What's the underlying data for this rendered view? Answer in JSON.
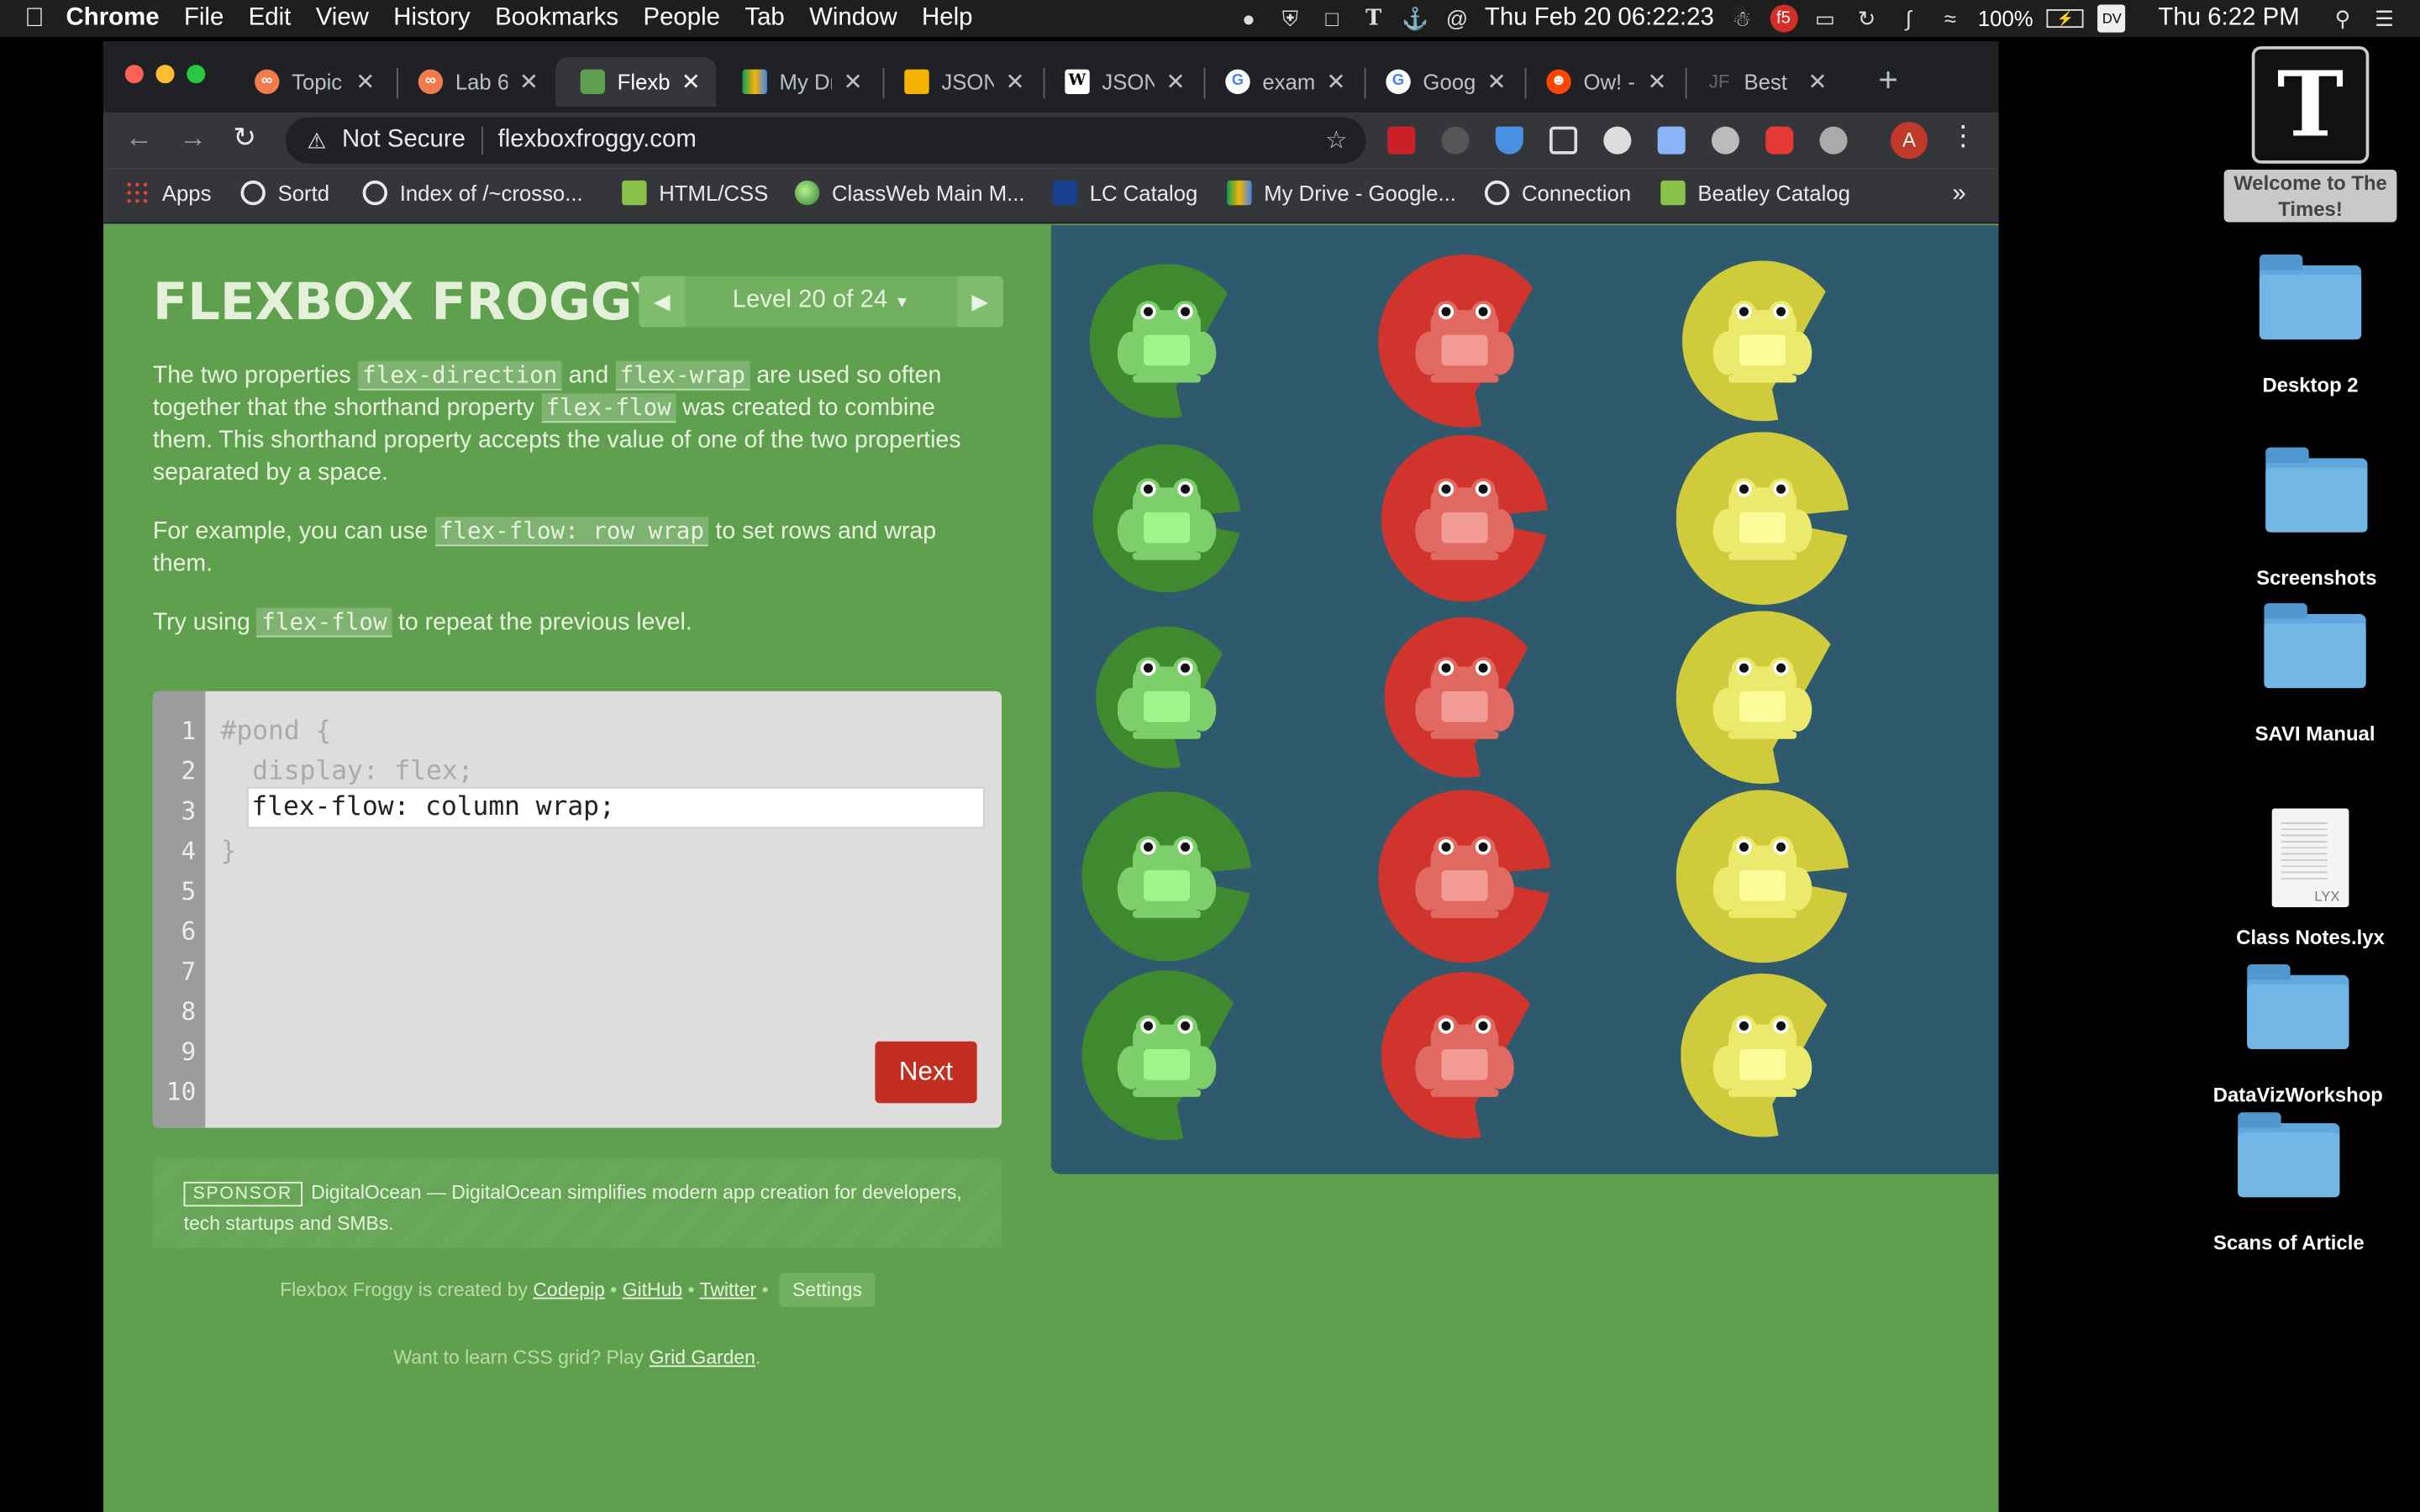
{
  "menubar": {
    "app": "Chrome",
    "items": [
      "File",
      "Edit",
      "View",
      "History",
      "Bookmarks",
      "People",
      "Tab",
      "Window",
      "Help"
    ],
    "clock_center": "Thu Feb 20 06:22:23",
    "battery": "100%",
    "clock": "Thu 6:22 PM"
  },
  "desktop": {
    "items": [
      {
        "label": "Welcome to The Times!",
        "icon": "nyt-icon"
      },
      {
        "label": "Desktop 2",
        "icon": "folder-icon"
      },
      {
        "label": "Screenshots",
        "icon": "folder-icon"
      },
      {
        "label": "SAVI Manual",
        "icon": "folder-icon"
      },
      {
        "label": "Class Notes.lyx",
        "icon": "document-icon",
        "ext": "LYX"
      },
      {
        "label": "DataVizWorkshop",
        "icon": "folder-icon"
      },
      {
        "label": "Scans of Article",
        "icon": "folder-icon"
      }
    ]
  },
  "browser": {
    "tabs": [
      {
        "title": "Topic",
        "icon": "codepen-icon",
        "color": "#f27a4b"
      },
      {
        "title": "Lab 6",
        "icon": "codepen-icon",
        "color": "#f27a4b"
      },
      {
        "title": "Flexbox",
        "icon": "frog-icon",
        "color": "#5fa04e",
        "active": true
      },
      {
        "title": "My Dr",
        "icon": "drive-icon",
        "color": "#f4b400"
      },
      {
        "title": "JSON",
        "icon": "slides-icon",
        "color": "#f4b400"
      },
      {
        "title": "JSON",
        "icon": "wikipedia-icon",
        "color": "#ffffff"
      },
      {
        "title": "examp",
        "icon": "google-icon",
        "color": "#ffffff"
      },
      {
        "title": "Goog",
        "icon": "google-icon",
        "color": "#ffffff"
      },
      {
        "title": "Ow! -",
        "icon": "reddit-icon",
        "color": "#ff4500"
      },
      {
        "title": "Best",
        "icon": "jf-icon",
        "color": "#444444"
      }
    ],
    "security": "Not Secure",
    "url": "flexboxfroggy.com",
    "profile_initial": "A",
    "bookmarks": [
      {
        "label": "Apps",
        "icon": "apps-grid-icon"
      },
      {
        "label": "Sortd",
        "icon": "globe-icon"
      },
      {
        "label": "Index of /~crosso...",
        "icon": "globe-icon"
      },
      {
        "label": "HTML/CSS",
        "icon": "s-icon"
      },
      {
        "label": "ClassWeb Main M...",
        "icon": "green-orb-icon"
      },
      {
        "label": "LC Catalog",
        "icon": "lc-icon"
      },
      {
        "label": "My Drive - Google...",
        "icon": "drive-icon"
      },
      {
        "label": "Connection",
        "icon": "globe-icon"
      },
      {
        "label": "Beatley Catalog",
        "icon": "s-icon"
      }
    ],
    "bookmarks_more": "»"
  },
  "game": {
    "title": "FLEXBOX FROGGY",
    "level_label": "Level 20 of 24",
    "p1": {
      "a": "The two properties ",
      "k1": "flex-direction",
      "b": " and ",
      "k2": "flex-wrap",
      "c": " are used so often together that the shorthand property ",
      "k3": "flex-flow",
      "d": " was created to combine them. This shorthand property accepts the value of one of the two properties separated by a space."
    },
    "p2": {
      "a": "For example, you can use ",
      "k1": "flex-flow: row wrap",
      "b": " to set rows and wrap them."
    },
    "p3": {
      "a": "Try using ",
      "k1": "flex-flow",
      "b": " to repeat the previous level."
    },
    "editor": {
      "line_numbers": [
        "1",
        "2",
        "3",
        "4",
        "5",
        "6",
        "7",
        "8",
        "9",
        "10"
      ],
      "line1": "#pond {",
      "line2": "  display: flex;",
      "line4": "}",
      "answer": "flex-flow: column wrap;"
    },
    "next_label": "Next",
    "sponsor": {
      "tag": "SPONSOR",
      "text": "DigitalOcean — DigitalOcean simplifies modern app creation for developers, tech startups and SMBs."
    },
    "footer": {
      "created_by": "Flexbox Froggy is created by",
      "codepip": "Codepip",
      "github": "GitHub",
      "twitter": "Twitter",
      "settings": "Settings",
      "grid_prefix": "Want to learn CSS grid? Play",
      "grid_link": "Grid Garden",
      "grid_suffix": "."
    },
    "pond": {
      "columns": [
        {
          "color": "green",
          "pad": "#3f8a2f",
          "frog": "#7ccf6a",
          "belly": "#9ef58a",
          "frogs": 5
        },
        {
          "color": "red",
          "pad": "#d0342c",
          "frog": "#e06a62",
          "belly": "#f29b94",
          "frogs": 5
        },
        {
          "color": "yellow",
          "pad": "#cfcb3a",
          "frog": "#ecea6c",
          "belly": "#fdfc9a",
          "frogs": 5
        }
      ]
    }
  }
}
